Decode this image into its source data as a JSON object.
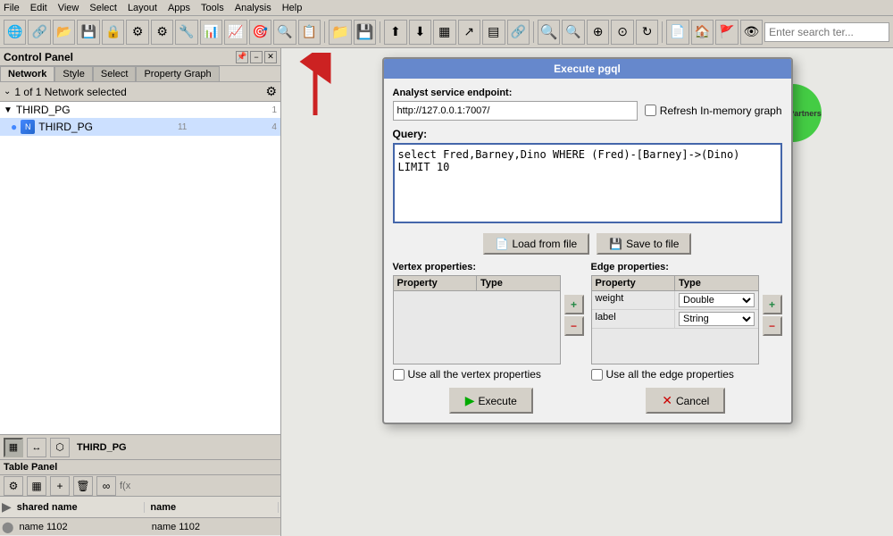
{
  "menubar": {
    "items": [
      "File",
      "Edit",
      "View",
      "Select",
      "Layout",
      "Apps",
      "Tools",
      "Analysis",
      "Help"
    ]
  },
  "toolbar": {
    "search_placeholder": "Enter search ter..."
  },
  "control_panel": {
    "title": "Control Panel",
    "tabs": [
      "Network",
      "Style",
      "Select",
      "Property Graph"
    ],
    "active_tab": "Network",
    "status": "1 of 1 Network selected",
    "tree": {
      "root": {
        "label": "THIRD_PG",
        "count": "1",
        "children": [
          {
            "label": "THIRD_PG",
            "count1": "11",
            "count2": "4"
          }
        ]
      }
    }
  },
  "table_panel": {
    "title": "Table Panel",
    "network_name": "THIRD_PG",
    "columns": [
      "shared name",
      "name"
    ],
    "rows": [
      {
        "col1": "name 1102",
        "col2": "name 1102"
      }
    ]
  },
  "dialog": {
    "title": "Execute pgql",
    "endpoint_label": "Analyst service endpoint:",
    "endpoint_value": "http://127.0.0.1:7007/",
    "refresh_label": "Refresh In-memory graph",
    "query_label": "Query:",
    "query_value": "select Fred,Barney,Dino WHERE (Fred)-[Barney]->(Dino) LIMIT 10",
    "load_btn": "Load from file",
    "save_btn": "Save to file",
    "vertex_props_label": "Vertex properties:",
    "vertex_columns": [
      "Property",
      "Type"
    ],
    "edge_props_label": "Edge properties:",
    "edge_columns": [
      "Property",
      "Type"
    ],
    "edge_rows": [
      {
        "property": "weight",
        "type": "Double"
      },
      {
        "property": "label",
        "type": "String"
      }
    ],
    "use_vertex_label": "Use all the vertex properties",
    "use_edge_label": "Use all the edge properties",
    "execute_btn": "Execute",
    "cancel_btn": "Cancel"
  },
  "karen": {
    "label": "Karen Partners"
  }
}
